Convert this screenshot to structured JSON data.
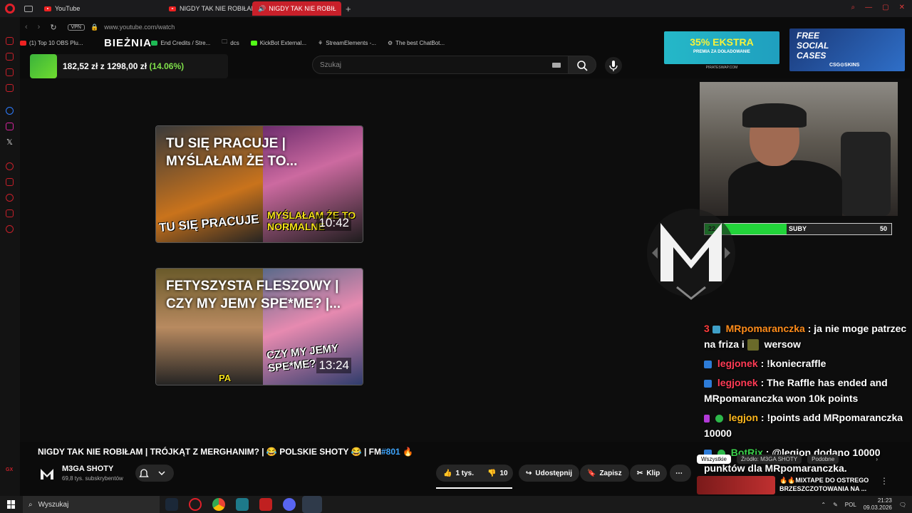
{
  "browser": {
    "tabs": [
      {
        "label": "YouTube",
        "active": false
      },
      {
        "label": "NIGDY TAK NIE ROBIŁAM",
        "active": false
      },
      {
        "label": "NIGDY TAK NIE ROBIŁ",
        "active": true
      }
    ],
    "vpn_label": "VPN",
    "url": "www.youtube.com/watch",
    "bookmarks": [
      "(1) Top 10 OBS Plu...",
      "End Credits / Stre...",
      "dcs",
      "KickBot External...",
      "StreamElements -...",
      "The best ChatBot..."
    ],
    "accent": "#c8202a"
  },
  "overlay": {
    "bieznia_label": "BIEŻNIA",
    "ticker_current": "182,52 zł",
    "ticker_separator": "z",
    "ticker_goal": "1298,00 zł",
    "ticker_percent": "(14.06%)",
    "sub_bar": {
      "left": "22",
      "label": "SUBY",
      "right": "50",
      "progress": 0.44,
      "color": "#22d43a"
    }
  },
  "youtube": {
    "search_placeholder": "Szukaj",
    "video_cards": [
      {
        "title": "TU SIĘ PRACUJE | MYŚLAŁAM ŻE TO...",
        "duration": "10:42",
        "caption_left": "TU SIĘ PRACUJE",
        "caption_right": "MYŚLAŁAM ŻE TO NORMALNE"
      },
      {
        "title": "FETYSZYSTA FLESZOWY | CZY MY JEMY SPE*ME? |...",
        "duration": "13:24",
        "caption_left": "PA",
        "caption_right": "CZY MY JEMY SPE*ME?"
      }
    ],
    "video_title": "NIGDY TAK NIE ROBIŁAM | TRÓJKĄT Z MERGHANIM? | 😂 POLSKIE SHOTY 😂 | FM",
    "video_title_hash": "#801",
    "video_title_emoji": "🔥",
    "channel_name": "M3GA SHOTY",
    "channel_subs": "69,8 tys. subskrybentów",
    "likes": "1 tys.",
    "dislikes": "10",
    "share_label": "Udostępnij",
    "save_label": "Zapisz",
    "clip_label": "Klip",
    "more_label": "⋯",
    "rec_tabs": [
      "Wszystkie",
      "Źródło: M3GA SHOTY",
      "Podobne"
    ],
    "rec_title": "🔥🔥MIXTAPE DO OSTREGO BRZESZCZOTOWANIA NA ..."
  },
  "chat": [
    {
      "prefix": "3",
      "user": "MRpomaranczka",
      "user_color": "#ff8c1a",
      "text": ": ja nie moge patrzec na friza i",
      "text2": "wersow"
    },
    {
      "prefix": "",
      "user": "legjonek",
      "user_color": "#ff3b55",
      "text": ": !koniecraffle",
      "text2": ""
    },
    {
      "prefix": "",
      "user": "legjonek",
      "user_color": "#ff3b55",
      "text": ": The Raffle has ended and MRpomaranczka won 10k points",
      "text2": ""
    },
    {
      "prefix": "",
      "user": "legjon",
      "user_color": "#ffb81c",
      "text": ": !points add MRpomaranczka 10000",
      "text2": ""
    },
    {
      "prefix": "",
      "user": "BotRix",
      "user_color": "#3ad04a",
      "text": ": @legjon dodano 10000 punktów dla MRpomaranczka.",
      "text2": ""
    }
  ],
  "taskbar": {
    "search_label": "Wyszukaj",
    "lang": "POL",
    "time": "21:23",
    "date": "09.03.2026"
  }
}
